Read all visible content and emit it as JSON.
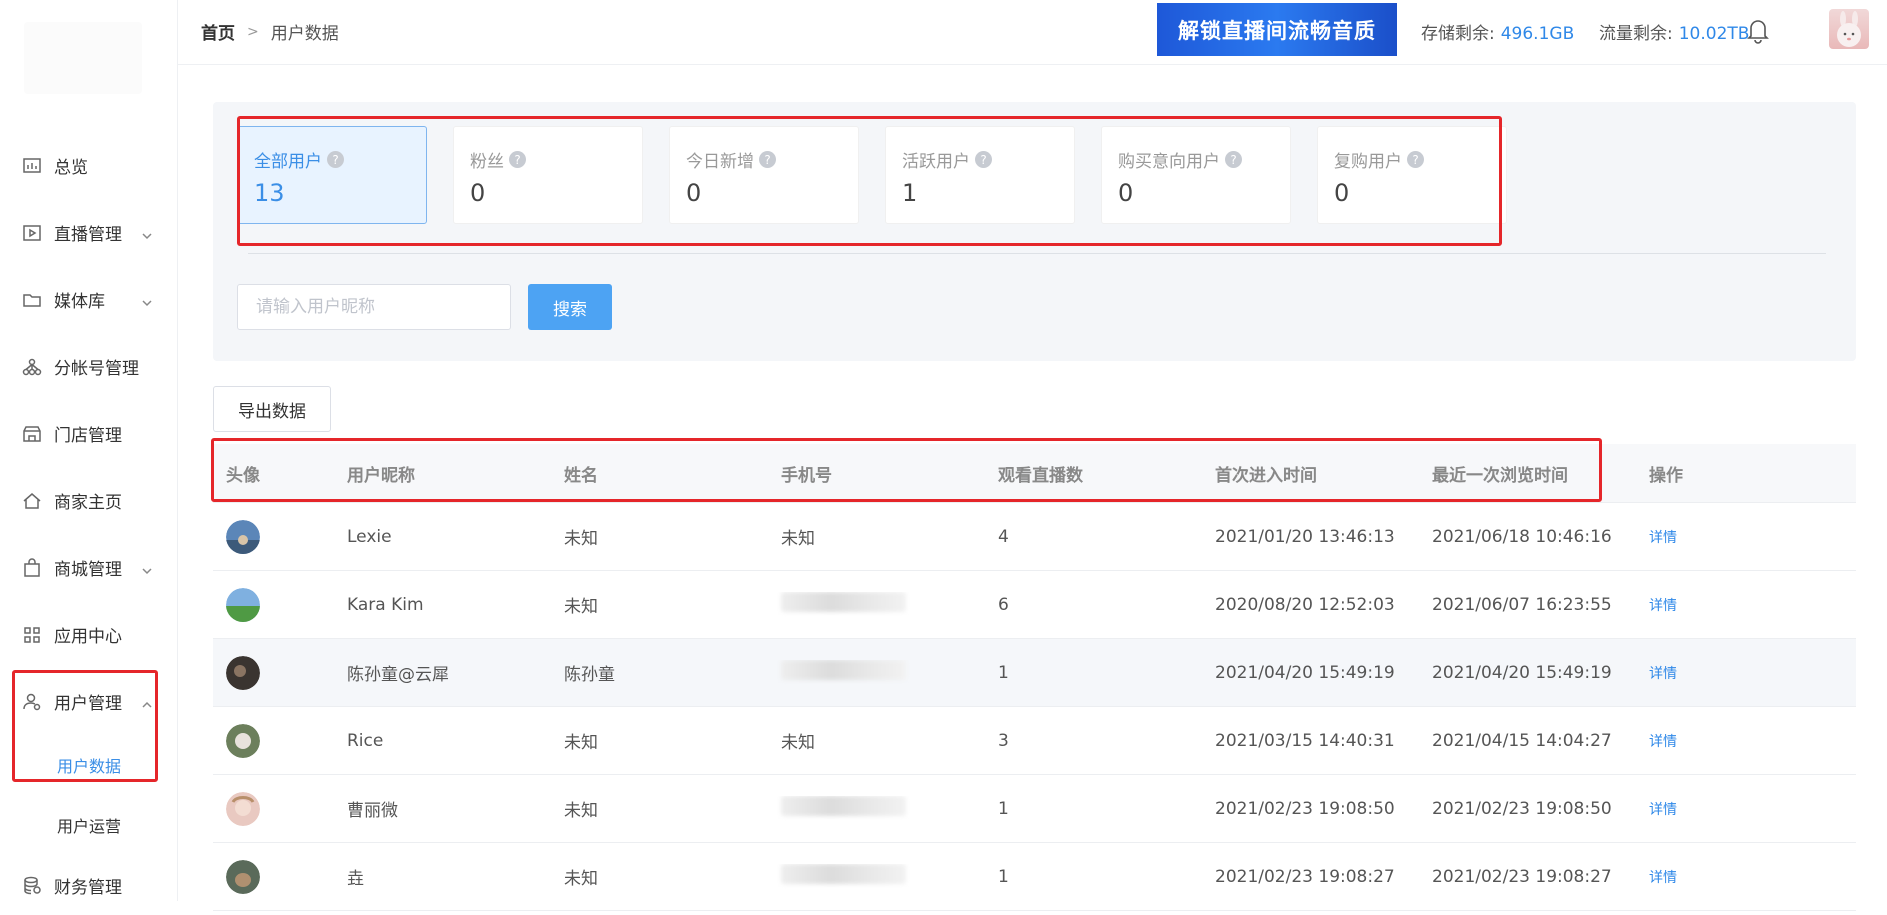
{
  "header": {
    "breadcrumb_home": "首页",
    "breadcrumb_current": "用户数据",
    "banner_text": "解锁直播间流畅音质",
    "storage_label": "存储剩余:",
    "storage_value": "496.1GB",
    "traffic_label": "流量剩余:",
    "traffic_value": "10.02TB"
  },
  "sidebar": {
    "items": [
      {
        "label": "总览",
        "icon": "chart-icon"
      },
      {
        "label": "直播管理",
        "icon": "play-icon",
        "expandable": true
      },
      {
        "label": "媒体库",
        "icon": "folder-icon",
        "expandable": true
      },
      {
        "label": "分帐号管理",
        "icon": "org-icon"
      },
      {
        "label": "门店管理",
        "icon": "store-icon"
      },
      {
        "label": "商家主页",
        "icon": "home-icon"
      },
      {
        "label": "商城管理",
        "icon": "bag-icon",
        "expandable": true
      },
      {
        "label": "应用中心",
        "icon": "grid-icon"
      },
      {
        "label": "用户管理",
        "icon": "user-icon",
        "expanded": true
      },
      {
        "label": "财务管理",
        "icon": "coins-icon"
      }
    ],
    "sub_items": [
      "用户数据",
      "用户运营"
    ]
  },
  "stats": [
    {
      "label": "全部用户",
      "value": "13",
      "active": true
    },
    {
      "label": "粉丝",
      "value": "0"
    },
    {
      "label": "今日新增",
      "value": "0"
    },
    {
      "label": "活跃用户",
      "value": "1"
    },
    {
      "label": "购买意向用户",
      "value": "0"
    },
    {
      "label": "复购用户",
      "value": "0"
    }
  ],
  "search": {
    "placeholder": "请输入用户昵称",
    "button": "搜索"
  },
  "export_button": "导出数据",
  "table": {
    "headers": [
      "头像",
      "用户昵称",
      "姓名",
      "手机号",
      "观看直播数",
      "首次进入时间",
      "最近一次浏览时间",
      "操作"
    ],
    "rows": [
      {
        "nickname": "Lexie",
        "name": "未知",
        "phone": "未知",
        "views": "4",
        "first": "2021/01/20 13:46:13",
        "last": "2021/06/18 10:46:16",
        "action": "详情"
      },
      {
        "nickname": "Kara Kim",
        "name": "未知",
        "phone": "",
        "views": "6",
        "first": "2020/08/20 12:52:03",
        "last": "2021/06/07 16:23:55",
        "action": "详情"
      },
      {
        "nickname": "陈孙童@云犀",
        "name": "陈孙童",
        "phone": "",
        "views": "1",
        "first": "2021/04/20 15:49:19",
        "last": "2021/04/20 15:49:19",
        "action": "详情"
      },
      {
        "nickname": "Rice",
        "name": "未知",
        "phone": "未知",
        "views": "3",
        "first": "2021/03/15 14:40:31",
        "last": "2021/04/15 14:04:27",
        "action": "详情"
      },
      {
        "nickname": "曹丽微",
        "name": "未知",
        "phone": "",
        "views": "1",
        "first": "2021/02/23 19:08:50",
        "last": "2021/02/23 19:08:50",
        "action": "详情"
      },
      {
        "nickname": "垚",
        "name": "未知",
        "phone": "",
        "views": "1",
        "first": "2021/02/23 19:08:27",
        "last": "2021/02/23 19:08:27",
        "action": "详情"
      }
    ]
  },
  "colors": {
    "accent": "#3a8ee6",
    "highlight": "#e5262a"
  }
}
